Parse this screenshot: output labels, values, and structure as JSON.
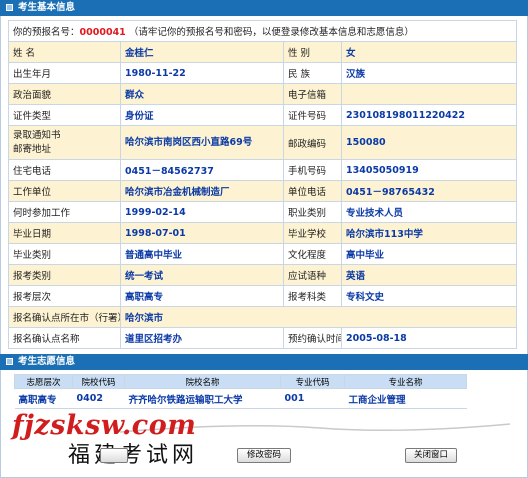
{
  "sections": {
    "basic_title": "考生基本信息",
    "wish_title": "考生志愿信息"
  },
  "registration": {
    "prefix": "你的预报名号：",
    "number": "0000041",
    "notice": "（请牢记你的预报名号和密码，以便登录修改基本信息和志愿信息）"
  },
  "basic_rows": [
    [
      {
        "l": "姓 名",
        "v": "金桂仁"
      },
      {
        "l": "性 别",
        "v": "女"
      }
    ],
    [
      {
        "l": "出生年月",
        "v": "1980-11-22"
      },
      {
        "l": "民 族",
        "v": "汉族"
      }
    ],
    [
      {
        "l": "政治面貌",
        "v": "群众"
      },
      {
        "l": "电子信箱",
        "v": ""
      }
    ],
    [
      {
        "l": "证件类型",
        "v": "身份证"
      },
      {
        "l": "证件号码",
        "v": "230108198011220422"
      }
    ],
    [
      {
        "l": "录取通知书\n邮寄地址",
        "v": "哈尔滨市南岗区西小直路69号"
      },
      {
        "l": "邮政编码",
        "v": "150080"
      }
    ],
    [
      {
        "l": "住宅电话",
        "v": "0451－84562737"
      },
      {
        "l": "手机号码",
        "v": "13405050919"
      }
    ],
    [
      {
        "l": "工作单位",
        "v": "哈尔滨市冶金机械制造厂"
      },
      {
        "l": "单位电话",
        "v": "0451－98765432"
      }
    ],
    [
      {
        "l": "何时参加工作",
        "v": "1999-02-14"
      },
      {
        "l": "职业类别",
        "v": "专业技术人员"
      }
    ],
    [
      {
        "l": "毕业日期",
        "v": "1998-07-01"
      },
      {
        "l": "毕业学校",
        "v": "哈尔滨市113中学"
      }
    ],
    [
      {
        "l": "毕业类别",
        "v": "普通高中毕业"
      },
      {
        "l": "文化程度",
        "v": "高中毕业"
      }
    ],
    [
      {
        "l": "报考类别",
        "v": "统一考试"
      },
      {
        "l": "应试语种",
        "v": "英语"
      }
    ],
    [
      {
        "l": "报考层次",
        "v": "高职高专"
      },
      {
        "l": "报考科类",
        "v": "专科文史"
      }
    ],
    [
      {
        "l": "报名确认点所在市（行署）",
        "v": "哈尔滨市"
      }
    ],
    [
      {
        "l": "报名确认点名称",
        "v": "道里区招考办"
      },
      {
        "l": "预约确认时间",
        "v": "2005-08-18"
      }
    ]
  ],
  "wish": {
    "headers": [
      "志愿层次",
      "院校代码",
      "院校名称",
      "专业代码",
      "专业名称"
    ],
    "rows": [
      [
        "高职高专",
        "0402",
        "齐齐哈尔铁路运输职工大学",
        "001",
        "工商企业管理"
      ]
    ]
  },
  "buttons": {
    "left": "",
    "change_password": "修改密码",
    "close_window": "关闭窗口"
  },
  "watermark": {
    "domain": "fjzsksw.com",
    "name": "福建考试网"
  },
  "colors": {
    "header_bg": "#1a6fb5",
    "odd_row": "#fdf3d2",
    "value_text": "#0b3aa6",
    "reg_number": "#e0181f"
  }
}
